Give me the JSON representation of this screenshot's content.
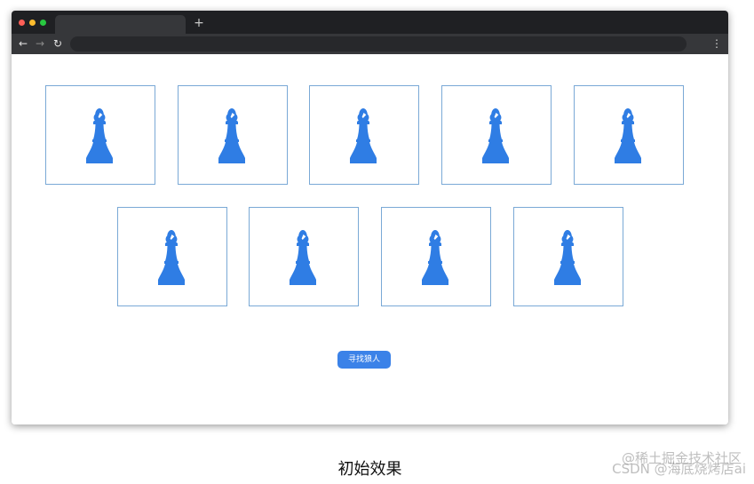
{
  "browser": {
    "new_tab_symbol": "+",
    "nav": {
      "back": "←",
      "forward": "→",
      "reload": "↻"
    },
    "menu_symbol": "⋮",
    "traffic_lights": {
      "red": "#ff5f57",
      "yellow": "#febc2e",
      "green": "#28c840"
    }
  },
  "page": {
    "card_border_color": "#7aa9d6",
    "piece_color": "#2f7de4",
    "piece_icon": "chess-bishop-icon",
    "button_label": "寻找狼人",
    "button_color": "#3b82e8"
  },
  "caption": "初始效果",
  "watermark": {
    "top": "@稀土掘金技术社区",
    "bottom": "CSDN @海底烧烤店ai"
  }
}
